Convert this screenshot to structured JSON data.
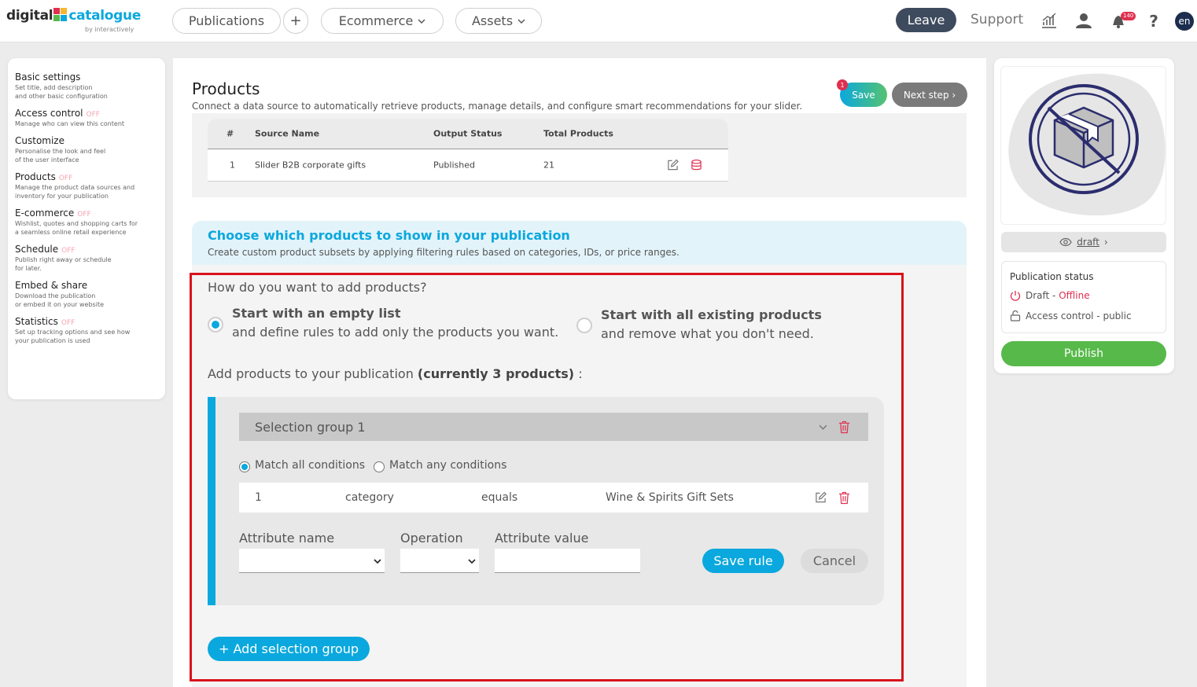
{
  "header": {
    "logo_left": "digital",
    "logo_right": "catalogue",
    "logo_sub": "by interactively",
    "nav": [
      "Publications",
      "+",
      "Ecommerce",
      "Assets"
    ],
    "leave": "Leave",
    "support": "Support",
    "notif_count": "140",
    "lang": "en"
  },
  "sidebar": {
    "off": "OFF",
    "items": [
      {
        "title": "Basic settings",
        "desc": "Set title, add description\nand other basic configuration",
        "off": false
      },
      {
        "title": "Access control",
        "desc": "Manage who can view this content",
        "off": true
      },
      {
        "title": "Customize",
        "desc": "Personalise the look and feel\nof the user interface",
        "off": false
      },
      {
        "title": "Products",
        "desc": "Manage the product data sources and\ninventory for your publication",
        "off": true
      },
      {
        "title": "E-commerce",
        "desc": "Wishlist, quotes and shopping carts for\na seamless online retail experience",
        "off": true
      },
      {
        "title": "Schedule",
        "desc": "Publish right away or schedule\nfor later.",
        "off": true
      },
      {
        "title": "Embed & share",
        "desc": "Download the publication\nor embed it on your website",
        "off": false
      },
      {
        "title": "Statistics",
        "desc": "Set up tracking options and see how\nyour publication is used",
        "off": true
      }
    ]
  },
  "main": {
    "title": "Products",
    "subtitle": "Connect a data source to automatically retrieve products, manage details, and configure smart recommendations for your slider.",
    "save": "Save",
    "save_badge": "1",
    "next": "Next step ›",
    "sources": {
      "headers": [
        "#",
        "Source Name",
        "Output Status",
        "Total Products"
      ],
      "rows": [
        {
          "num": "1",
          "name": "Slider B2B corporate gifts",
          "status": "Published",
          "total": "21"
        }
      ]
    },
    "choose": {
      "title": "Choose which products to show in your publication",
      "subtitle": "Create custom product subsets by applying filtering rules based on categories, IDs, or price ranges."
    },
    "how": "How do you want to add products?",
    "option1": {
      "title": "Start with an empty list",
      "sub": "and define rules to add only the products you want."
    },
    "option2": {
      "title": "Start with all existing products",
      "sub": "and remove what you don't need."
    },
    "add_products": "Add products to your publication",
    "add_products_count": "(currently 3 products)",
    "add_products_colon": " :",
    "group": {
      "title": "Selection group 1",
      "match_all": "Match all conditions",
      "match_any": "Match any conditions",
      "rule": {
        "num": "1",
        "attribute": "category",
        "operation": "equals",
        "value": "Wine & Spirits Gift Sets"
      },
      "attr_name_label": "Attribute name",
      "operation_label": "Operation",
      "attr_value_label": "Attribute value",
      "save_rule": "Save rule",
      "cancel": "Cancel"
    },
    "add_group": "+ Add selection group"
  },
  "right": {
    "draft_link": "draft",
    "draft_arrow": "›",
    "status_title": "Publication status",
    "draft_label": "Draft - ",
    "offline": "Offline",
    "access_label": "Access control -  public",
    "publish": "Publish"
  },
  "colors": {
    "accent": "#0aa8de",
    "publish": "#57b94a",
    "highlight": "#d9121c",
    "dark": "#3e4b5e",
    "off": "#f6a5b1"
  }
}
